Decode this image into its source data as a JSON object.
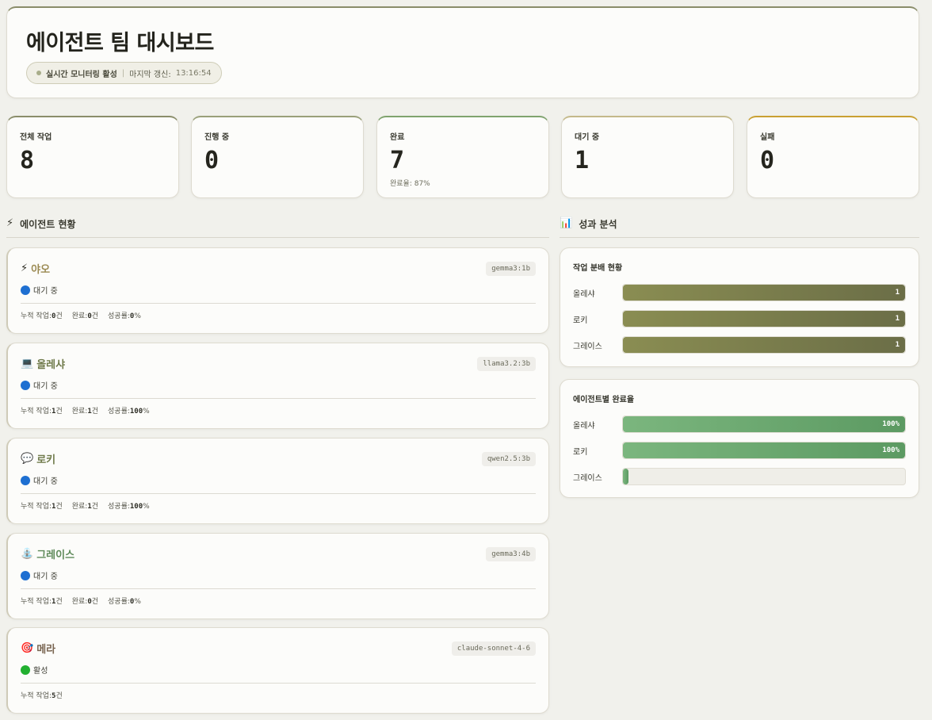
{
  "header": {
    "title": "에이전트 팀 대시보드",
    "live_label": "실시간 모니터링 활성",
    "separator": "|",
    "refresh_label": "마지막 갱신:",
    "refresh_time": "13:16:54"
  },
  "stats": [
    {
      "label": "전체 작업",
      "value": "8",
      "sub": "",
      "accent": "#8a8d6a"
    },
    {
      "label": "진행 중",
      "value": "0",
      "sub": "",
      "accent": "#9aa07a"
    },
    {
      "label": "완료",
      "value": "7",
      "sub": "완료율: 87%",
      "accent": "#7fa36e"
    },
    {
      "label": "대기 중",
      "value": "1",
      "sub": "",
      "accent": "#c4b98a"
    },
    {
      "label": "실패",
      "value": "0",
      "sub": "",
      "accent": "#c9a032"
    }
  ],
  "sections": {
    "agents_title": "에이전트 현황",
    "agents_icon": "⚡",
    "analysis_title": "성과 분석",
    "analysis_icon": "📊"
  },
  "agents": [
    {
      "icon": "⚡",
      "name": "야오",
      "name_color": "#9b8a52",
      "model": "gemma3:1b",
      "status": "대기 중",
      "status_color": "#1e6fd1",
      "metrics": [
        {
          "label": "누적 작업:",
          "value": "0",
          "unit": "건"
        },
        {
          "label": "완료:",
          "value": "0",
          "unit": "건"
        },
        {
          "label": "성공률:",
          "value": "0",
          "unit": "%"
        }
      ]
    },
    {
      "icon": "💻",
      "name": "올레샤",
      "name_color": "#6f7a4a",
      "model": "llama3.2:3b",
      "status": "대기 중",
      "status_color": "#1e6fd1",
      "metrics": [
        {
          "label": "누적 작업:",
          "value": "1",
          "unit": "건"
        },
        {
          "label": "완료:",
          "value": "1",
          "unit": "건"
        },
        {
          "label": "성공률:",
          "value": "100",
          "unit": "%"
        }
      ]
    },
    {
      "icon": "💬",
      "name": "로키",
      "name_color": "#6f7a4a",
      "model": "qwen2.5:3b",
      "status": "대기 중",
      "status_color": "#1e6fd1",
      "metrics": [
        {
          "label": "누적 작업:",
          "value": "1",
          "unit": "건"
        },
        {
          "label": "완료:",
          "value": "1",
          "unit": "건"
        },
        {
          "label": "성공률:",
          "value": "100",
          "unit": "%"
        }
      ]
    },
    {
      "icon": "⛲",
      "name": "그레이스",
      "name_color": "#5f8a5a",
      "model": "gemma3:4b",
      "status": "대기 중",
      "status_color": "#1e6fd1",
      "metrics": [
        {
          "label": "누적 작업:",
          "value": "1",
          "unit": "건"
        },
        {
          "label": "완료:",
          "value": "0",
          "unit": "건"
        },
        {
          "label": "성공률:",
          "value": "0",
          "unit": "%"
        }
      ]
    },
    {
      "icon": "🎯",
      "name": "메라",
      "name_color": "#7a6652",
      "model": "claude-sonnet-4-6",
      "status": "활성",
      "status_color": "#22b030",
      "metrics": [
        {
          "label": "누적 작업:",
          "value": "5",
          "unit": "건"
        }
      ]
    }
  ],
  "analysis": {
    "distribution": {
      "title": "작업 분배 현황",
      "rows": [
        {
          "label": "올레샤",
          "value": "1",
          "fraction": 1.0
        },
        {
          "label": "로키",
          "value": "1",
          "fraction": 1.0
        },
        {
          "label": "그레이스",
          "value": "1",
          "fraction": 1.0
        }
      ]
    },
    "completion": {
      "title": "에이전트별 완료율",
      "rows": [
        {
          "label": "올레샤",
          "value": "100%",
          "fraction": 1.0
        },
        {
          "label": "로키",
          "value": "100%",
          "fraction": 1.0
        },
        {
          "label": "그레이스",
          "value": "",
          "fraction": 0.0
        }
      ]
    }
  }
}
